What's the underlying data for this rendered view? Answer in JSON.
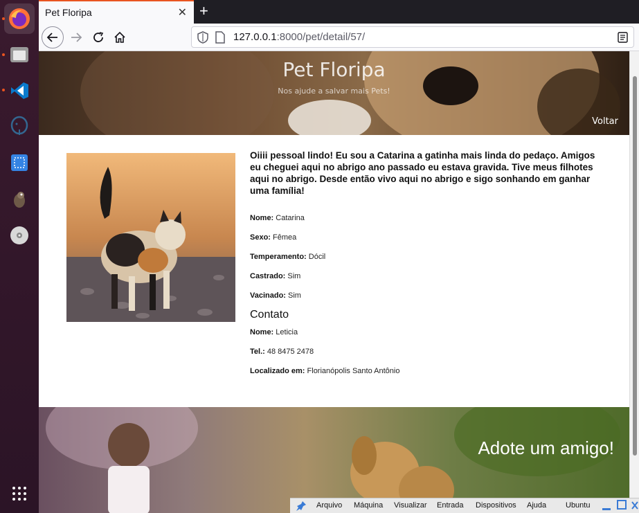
{
  "dock": {
    "items": [
      "firefox-icon",
      "files-icon",
      "vscode-icon",
      "postgres-icon",
      "screenshot-icon",
      "gimp-icon",
      "disc-icon",
      "apps-grid-icon"
    ]
  },
  "browser": {
    "tab_title": "Pet Floripa",
    "url_host": "127.0.0.1",
    "url_rest": ":8000/pet/detail/57/"
  },
  "hero": {
    "title": "Pet Floripa",
    "subtitle": "Nos ajude a salvar mais Pets!",
    "back_label": "Voltar"
  },
  "pet": {
    "description": "Oiiii pessoal lindo! Eu sou a Catarina a gatinha mais linda do pedaço. Amigos eu cheguei aqui no abrigo ano passado eu estava gravida. Tive meus filhotes aqui no abrigo. Desde então vivo aqui no abrigo e sigo sonhando em ganhar uma família!",
    "fields": [
      {
        "label": "Nome:",
        "value": "Catarina"
      },
      {
        "label": "Sexo:",
        "value": "Fêmea"
      },
      {
        "label": "Temperamento:",
        "value": "Dócil"
      },
      {
        "label": "Castrado:",
        "value": "Sim"
      },
      {
        "label": "Vacinado:",
        "value": "Sim"
      }
    ]
  },
  "contact": {
    "heading": "Contato",
    "fields": [
      {
        "label": "Nome:",
        "value": "Leticia"
      },
      {
        "label": "Tel.:",
        "value": "48 8475 2478"
      },
      {
        "label": "Localizado em:",
        "value": "Florianópolis Santo Antônio"
      }
    ]
  },
  "footer": {
    "title": "Adote um amigo!"
  },
  "vbox": {
    "menus": [
      "Arquivo",
      "Máquina",
      "Visualizar",
      "Entrada",
      "Dispositivos",
      "Ajuda"
    ],
    "host": "Ubuntu"
  }
}
